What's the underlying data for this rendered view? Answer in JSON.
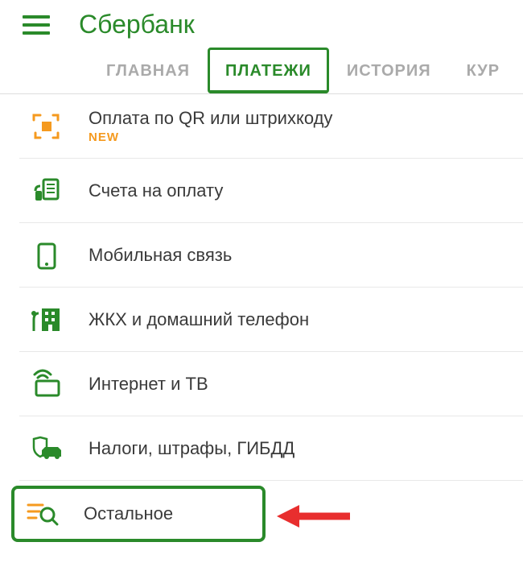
{
  "header": {
    "title": "Сбербанк"
  },
  "tabs": [
    {
      "label": "ГЛАВНАЯ",
      "active": false
    },
    {
      "label": "ПЛАТЕЖИ",
      "active": true
    },
    {
      "label": "ИСТОРИЯ",
      "active": false
    },
    {
      "label": "КУР",
      "active": false
    }
  ],
  "items": [
    {
      "label": "Оплата по QR или штрихкоду",
      "badge": "NEW",
      "icon": "qr"
    },
    {
      "label": "Счета на оплату",
      "icon": "invoice"
    },
    {
      "label": "Мобильная связь",
      "icon": "mobile"
    },
    {
      "label": "ЖКХ и домашний телефон",
      "icon": "building"
    },
    {
      "label": "Интернет и ТВ",
      "icon": "internet"
    },
    {
      "label": "Налоги, штрафы, ГИБДД",
      "icon": "car"
    },
    {
      "label": "Остальное",
      "icon": "search"
    }
  ],
  "colors": {
    "brand": "#2a8a2a",
    "accent": "#f59a1f",
    "arrow": "#e82e2e"
  }
}
